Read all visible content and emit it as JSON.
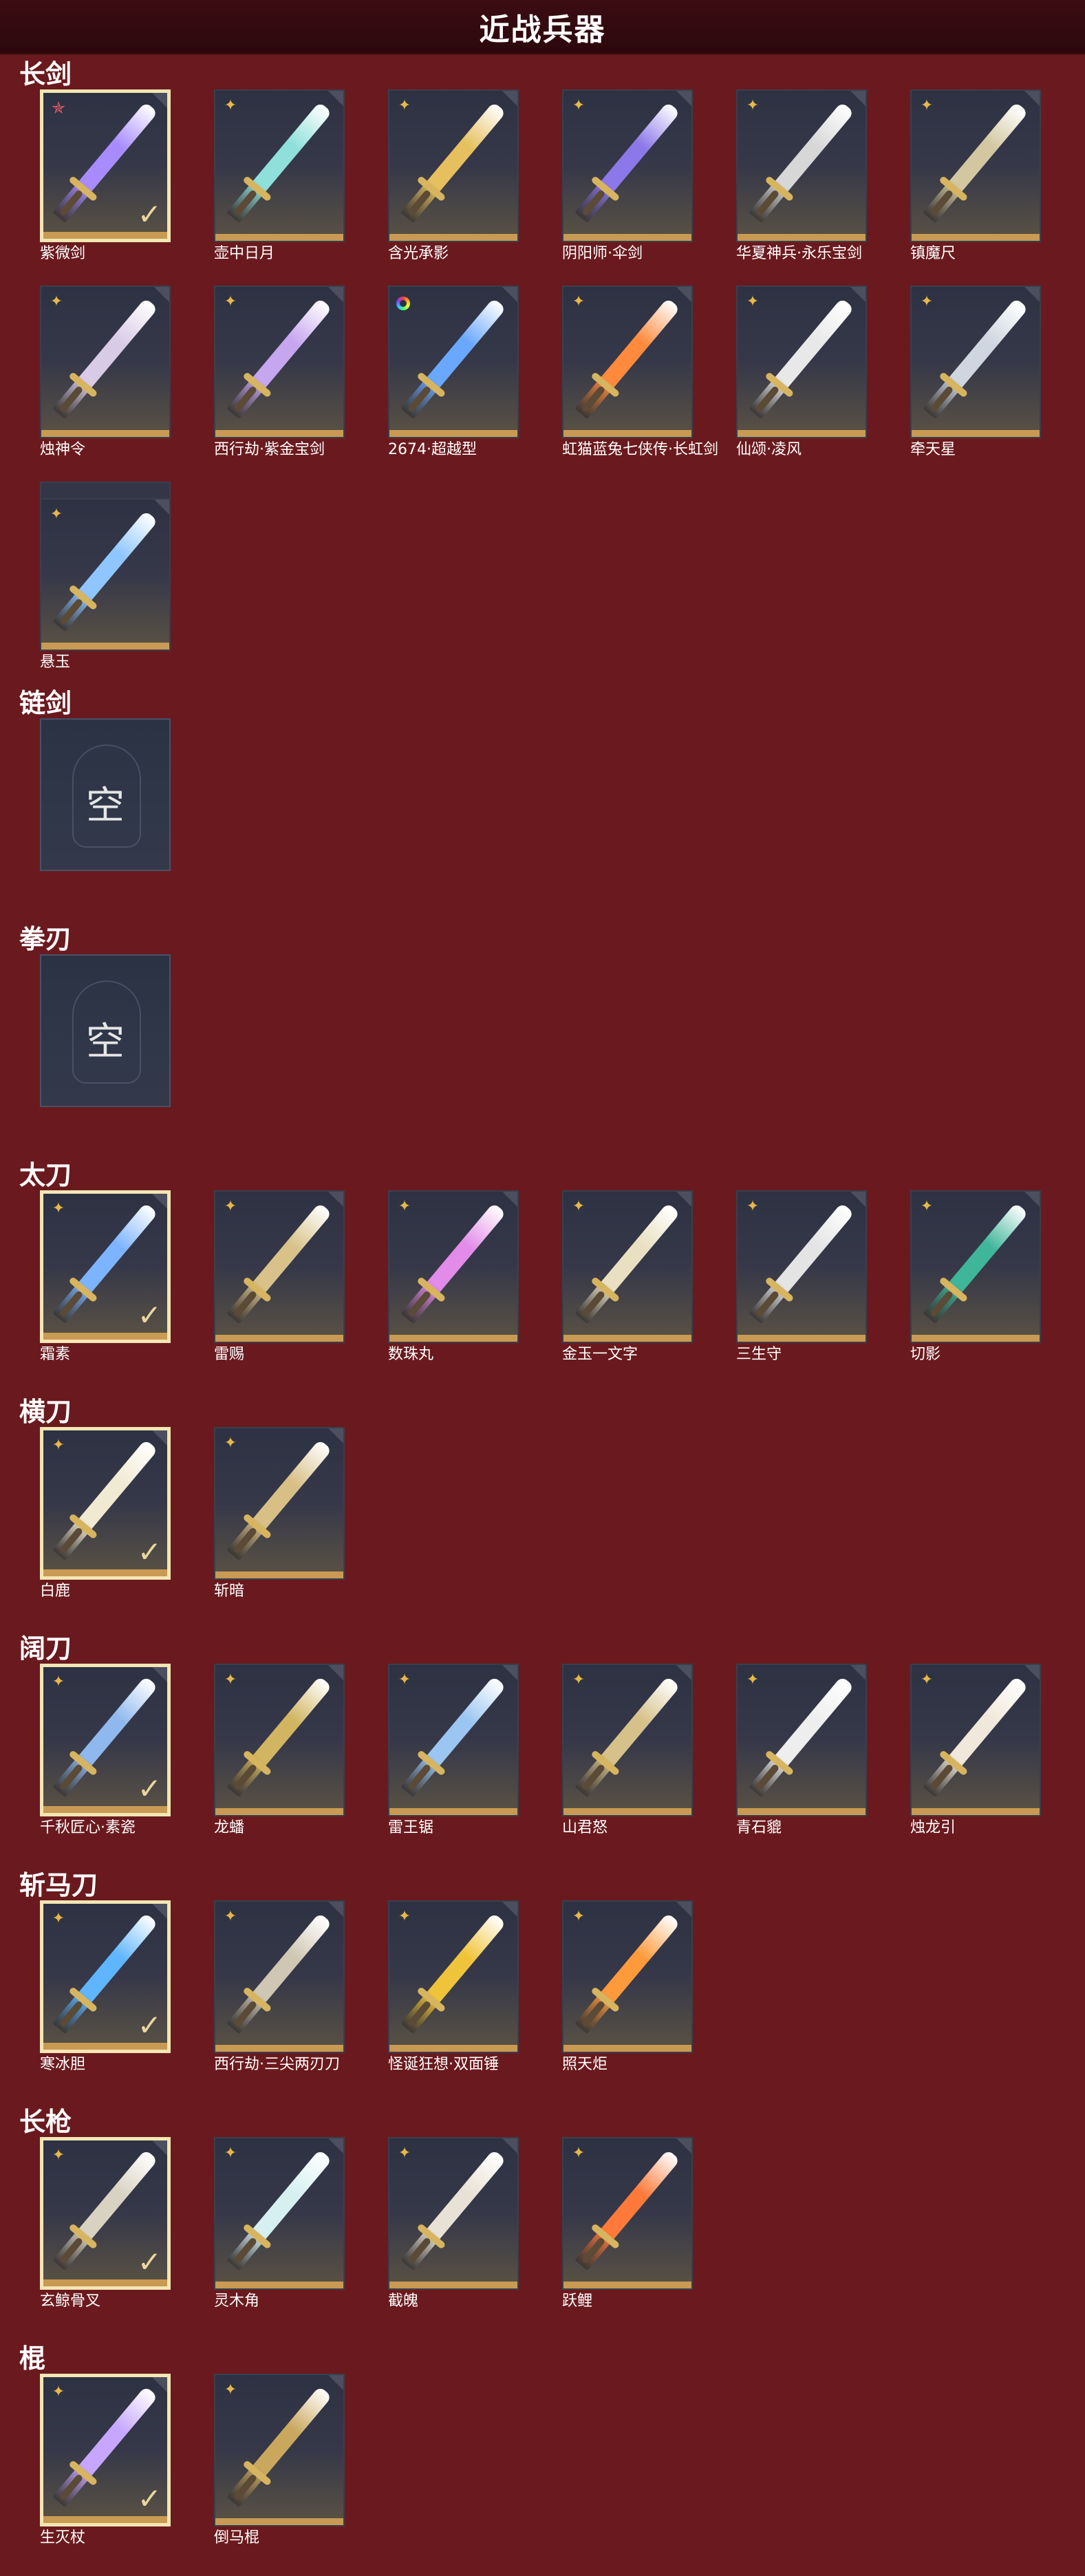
{
  "header": {
    "title": "近战兵器"
  },
  "sections": [
    {
      "title": "长剑",
      "items": [
        {
          "name": "紫微剑",
          "rarity": "red",
          "selected": true,
          "color": "#a88cff"
        },
        {
          "name": "壶中日月",
          "rarity": "gold",
          "selected": false,
          "color": "#8fe0da"
        },
        {
          "name": "含光承影",
          "rarity": "gold",
          "selected": false,
          "color": "#e6c05e"
        },
        {
          "name": "阴阳师·伞剑",
          "rarity": "gold",
          "selected": false,
          "color": "#8c78e8"
        },
        {
          "name": "华夏神兵·永乐宝剑",
          "rarity": "gold",
          "selected": false,
          "color": "#d7d7d7"
        },
        {
          "name": "镇魔尺",
          "rarity": "gold",
          "selected": false,
          "color": "#d2c7a0"
        },
        {
          "name": "烛神令",
          "rarity": "gold",
          "selected": false,
          "color": "#d8cbe6"
        },
        {
          "name": "西行劫·紫金宝剑",
          "rarity": "gold",
          "selected": false,
          "color": "#c6a6ee"
        },
        {
          "name": "2674·超越型",
          "rarity": "rainbow",
          "selected": false,
          "color": "#6aa8ff"
        },
        {
          "name": "虹猫蓝兔七侠传·长虹剑",
          "rarity": "gold",
          "selected": false,
          "color": "#ff8a3d"
        },
        {
          "name": "仙颂·凌风",
          "rarity": "gold",
          "selected": false,
          "color": "#e8e8e8"
        },
        {
          "name": "牵天星",
          "rarity": "gold",
          "selected": false,
          "color": "#cfd6e0"
        },
        {
          "name": "悬玉",
          "rarity": "gold",
          "selected": false,
          "color": "#8fc6ff",
          "stacked": true
        }
      ]
    },
    {
      "title": "链剑",
      "empty": true,
      "empty_label": "空"
    },
    {
      "title": "拳刃",
      "empty": true,
      "empty_label": "空"
    },
    {
      "title": "太刀",
      "items": [
        {
          "name": "霜素",
          "rarity": "gold",
          "selected": true,
          "color": "#7db4ff"
        },
        {
          "name": "雷赐",
          "rarity": "gold",
          "selected": false,
          "color": "#d8c28a"
        },
        {
          "name": "数珠丸",
          "rarity": "gold",
          "selected": false,
          "color": "#e28be8"
        },
        {
          "name": "金玉一文字",
          "rarity": "gold",
          "selected": false,
          "color": "#e8e0c0"
        },
        {
          "name": "三生守",
          "rarity": "gold",
          "selected": false,
          "color": "#e4e4e4"
        },
        {
          "name": "切影",
          "rarity": "gold",
          "selected": false,
          "color": "#3fb59a"
        }
      ]
    },
    {
      "title": "横刀",
      "items": [
        {
          "name": "白鹿",
          "rarity": "gold",
          "selected": true,
          "color": "#f1ead2"
        },
        {
          "name": "斩暗",
          "rarity": "gold",
          "selected": false,
          "color": "#d8bf86"
        }
      ]
    },
    {
      "title": "阔刀",
      "items": [
        {
          "name": "千秋匠心·素瓷",
          "rarity": "gold",
          "selected": true,
          "color": "#8fb8ee"
        },
        {
          "name": "龙蟠",
          "rarity": "gold",
          "selected": false,
          "color": "#d1b560"
        },
        {
          "name": "雷王锯",
          "rarity": "gold",
          "selected": false,
          "color": "#9cc6f2"
        },
        {
          "name": "山君怒",
          "rarity": "gold",
          "selected": false,
          "color": "#d6c18a"
        },
        {
          "name": "青石貔",
          "rarity": "gold",
          "selected": false,
          "color": "#eeeeee"
        },
        {
          "name": "烛龙引",
          "rarity": "gold",
          "selected": false,
          "color": "#f0e8da"
        }
      ]
    },
    {
      "title": "斩马刀",
      "items": [
        {
          "name": "寒冰胆",
          "rarity": "gold",
          "selected": true,
          "color": "#5fb6ff"
        },
        {
          "name": "西行劫·三尖两刃刀",
          "rarity": "gold",
          "selected": false,
          "color": "#cfc6b3"
        },
        {
          "name": "怪诞狂想·双面锤",
          "rarity": "gold",
          "selected": false,
          "color": "#f0c43a"
        },
        {
          "name": "照天炬",
          "rarity": "gold",
          "selected": false,
          "color": "#ff9a3c"
        }
      ]
    },
    {
      "title": "长枪",
      "items": [
        {
          "name": "玄鲸骨叉",
          "rarity": "gold",
          "selected": true,
          "color": "#d8d2c2"
        },
        {
          "name": "灵木角",
          "rarity": "gold",
          "selected": false,
          "color": "#d6f0f2"
        },
        {
          "name": "截魄",
          "rarity": "gold",
          "selected": false,
          "color": "#e8e2d6"
        },
        {
          "name": "跃鲤",
          "rarity": "gold",
          "selected": false,
          "color": "#ff7a3a"
        }
      ]
    },
    {
      "title": "棍",
      "items": [
        {
          "name": "生灭杖",
          "rarity": "gold",
          "selected": true,
          "color": "#c6a6ff"
        },
        {
          "name": "倒马棍",
          "rarity": "gold",
          "selected": false,
          "color": "#c9a85e"
        }
      ]
    }
  ]
}
